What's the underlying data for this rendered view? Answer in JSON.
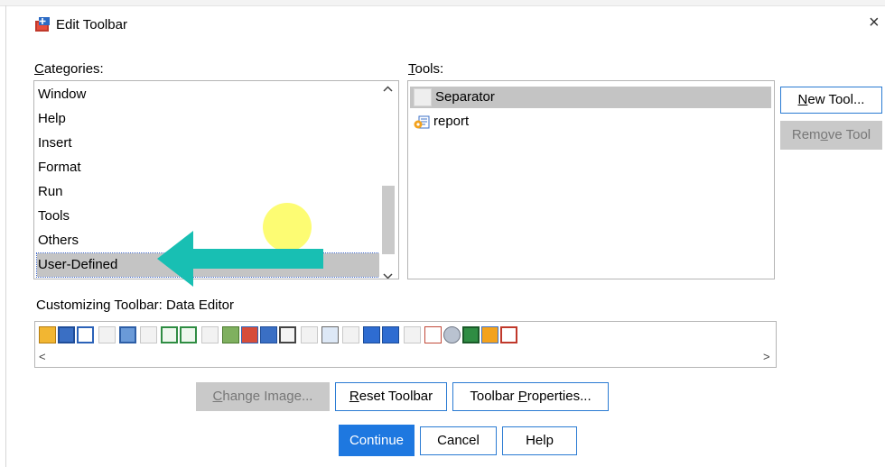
{
  "window": {
    "title": "Edit Toolbar",
    "close_glyph": "×"
  },
  "categories": {
    "label_underline": "C",
    "label_rest": "ategories:",
    "items": [
      "Window",
      "Help",
      "Insert",
      "Format",
      "Run",
      "Tools",
      "Others",
      "User-Defined"
    ],
    "selected": "User-Defined"
  },
  "tools": {
    "label_underline": "T",
    "label_rest": "ools:",
    "items": [
      {
        "label": "Separator",
        "icon": "separator-icon"
      },
      {
        "label": "report",
        "icon": "script-icon"
      }
    ]
  },
  "side_buttons": {
    "new_tool_underline": "N",
    "new_tool_rest": "ew Tool...",
    "remove_tool_prefix": "Rem",
    "remove_tool_underline": "o",
    "remove_tool_rest": "ve Tool"
  },
  "customizing": {
    "label": "Customizing Toolbar:",
    "target": "Data Editor",
    "scroll_left": "<",
    "scroll_right": ">"
  },
  "bottom_buttons": {
    "change_image_underline": "C",
    "change_image_rest": "hange Image...",
    "reset_underline": "R",
    "reset_rest": "eset Toolbar",
    "props_prefix": "Toolbar ",
    "props_underline": "P",
    "props_rest": "roperties...",
    "continue": "Continue",
    "cancel": "Cancel",
    "help": "Help"
  },
  "colors": {
    "accent": "#1e78e0",
    "pointer_arrow": "#18bfb3",
    "cursor_highlight": "#fdfb5b"
  }
}
